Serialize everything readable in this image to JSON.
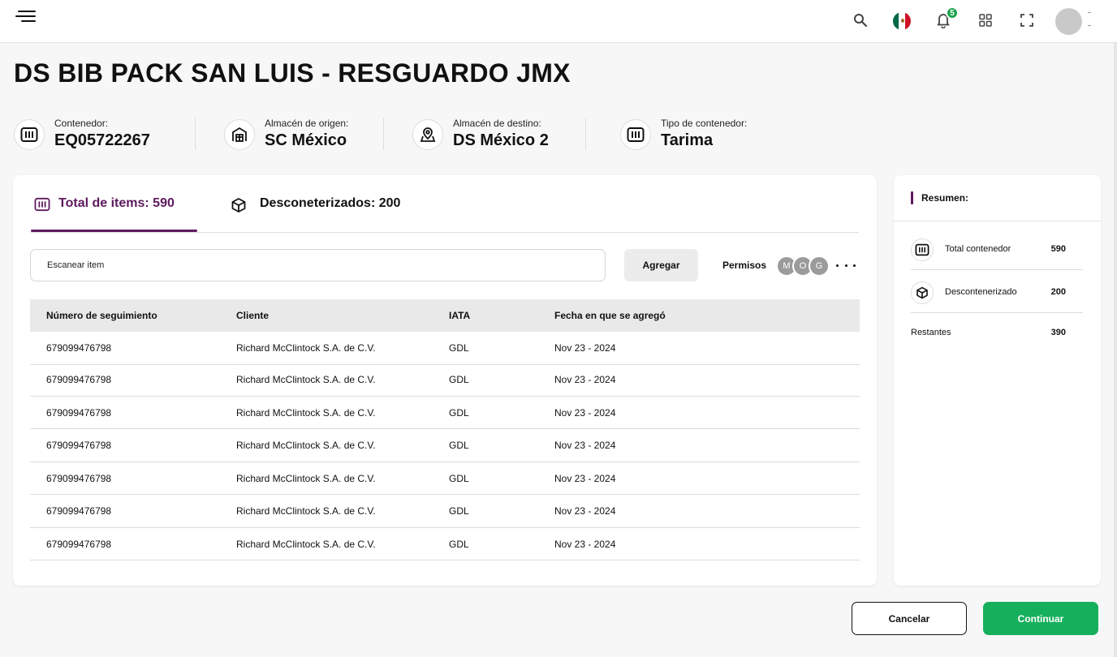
{
  "header": {
    "notification_count": "5",
    "flag_colors": [
      "#006847",
      "#ffffff",
      "#ce1126"
    ]
  },
  "page": {
    "title": "DS BIB PACK SAN LUIS - RESGUARDO JMX"
  },
  "info": [
    {
      "label": "Contenedor:",
      "value": "EQ05722267",
      "icon": "container-icon"
    },
    {
      "label": "Almacén de origen:",
      "value": "SC México",
      "icon": "warehouse-icon"
    },
    {
      "label": "Almacén de destino:",
      "value": "DS México 2",
      "icon": "map-pin-icon"
    },
    {
      "label": "Tipo de contenedor:",
      "value": "Tarima",
      "icon": "container-icon"
    }
  ],
  "tabs": [
    {
      "label": "Total de items: 590",
      "icon": "container-icon",
      "active": true
    },
    {
      "label": "Desconeterizados: 200",
      "icon": "box-icon",
      "active": false
    }
  ],
  "scan": {
    "placeholder": "Escanear item"
  },
  "actions": {
    "add_label": "Agregar",
    "permissions_label": "Permisos",
    "permission_avatars": [
      "M",
      "O",
      "G"
    ]
  },
  "table": {
    "columns": [
      "Número de seguimiento",
      "Cliente",
      "IATA",
      "Fecha en que se agregó"
    ],
    "rows": [
      [
        "679099476798",
        "Richard McClintock S.A. de C.V.",
        "GDL",
        "Nov 23 - 2024"
      ],
      [
        "679099476798",
        "Richard McClintock S.A. de C.V.",
        "GDL",
        "Nov 23 - 2024"
      ],
      [
        "679099476798",
        "Richard McClintock S.A. de C.V.",
        "GDL",
        "Nov 23 - 2024"
      ],
      [
        "679099476798",
        "Richard McClintock S.A. de C.V.",
        "GDL",
        "Nov 23 - 2024"
      ],
      [
        "679099476798",
        "Richard McClintock S.A. de C.V.",
        "GDL",
        "Nov 23 - 2024"
      ],
      [
        "679099476798",
        "Richard McClintock S.A. de C.V.",
        "GDL",
        "Nov 23 - 2024"
      ],
      [
        "679099476798",
        "Richard McClintock S.A. de C.V.",
        "GDL",
        "Nov 23 - 2024"
      ]
    ]
  },
  "summary": {
    "title": "Resumen:",
    "items": [
      {
        "label": "Total contenedor",
        "value": "590",
        "icon": "container-icon"
      },
      {
        "label": "Descontenerizado",
        "value": "200",
        "icon": "box-icon"
      },
      {
        "label": "Restantes",
        "value": "390"
      }
    ]
  },
  "footer": {
    "cancel_label": "Cancelar",
    "continue_label": "Continuar"
  },
  "colors": {
    "accent": "#5d1a5e",
    "primary": "#16b05c"
  }
}
